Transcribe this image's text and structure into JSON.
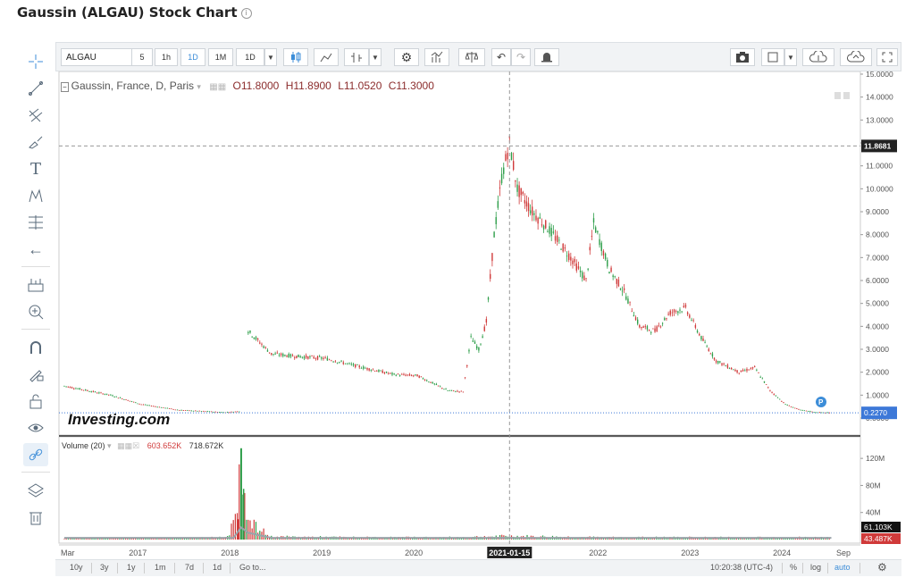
{
  "page_title": "Gaussin (ALGAU) Stock Chart",
  "toolbar": {
    "symbol": "ALGAU",
    "intervals": [
      "5",
      "1h",
      "1D",
      "1M",
      "1D"
    ],
    "selected_interval": "1D"
  },
  "legend": {
    "name": "Gaussin, France, D, Paris",
    "open": "O11.8000",
    "high": "H11.8900",
    "low": "L11.0520",
    "close": "C11.3000"
  },
  "volume_legend": {
    "label": "Volume (20)",
    "value1": "603.652K",
    "value2": "718.672K"
  },
  "watermark": "Investing.com",
  "bottom_bar": {
    "ranges": [
      "10y",
      "3y",
      "1y",
      "1m",
      "7d",
      "1d",
      "Go to..."
    ],
    "time": "10:20:38 (UTC-4)",
    "pct": "%",
    "log": "log",
    "auto": "auto"
  },
  "chart_data": {
    "type": "line",
    "title": "Gaussin, France, D, Paris",
    "x": [
      "2016-03",
      "2016-06",
      "2016-09",
      "2017-01",
      "2017-06",
      "2017-12",
      "2018-02",
      "2018-03",
      "2018-06",
      "2018-09",
      "2019-01",
      "2019-06",
      "2019-10",
      "2020-01",
      "2020-05",
      "2020-07",
      "2020-08",
      "2020-09",
      "2020-10",
      "2020-11",
      "2020-12",
      "2021-01",
      "2021-02",
      "2021-04",
      "2021-06",
      "2021-09",
      "2021-11",
      "2021-12",
      "2022-02",
      "2022-04",
      "2022-06",
      "2022-08",
      "2022-10",
      "2022-12",
      "2023-02",
      "2023-04",
      "2023-07",
      "2023-09",
      "2023-11",
      "2024-01",
      "2024-03",
      "2024-05",
      "2024-07"
    ],
    "series": [
      {
        "name": "",
        "values": [
          1.4,
          1.2,
          1.0,
          0.6,
          0.35,
          0.25,
          0.3,
          3.8,
          2.8,
          2.7,
          2.6,
          2.2,
          1.9,
          1.85,
          1.2,
          1.15,
          3.5,
          3.0,
          4.2,
          8.0,
          10.5,
          12.0,
          10.0,
          9.0,
          8.3,
          7.0,
          6.0,
          8.5,
          6.5,
          5.5,
          4.0,
          3.8,
          4.6,
          4.8,
          3.5,
          2.5,
          2.0,
          2.2,
          1.2,
          0.6,
          0.35,
          0.25,
          0.23
        ]
      }
    ],
    "volume": {
      "label": "Volume (20)",
      "dates": [
        "2016-03",
        "2017-01",
        "2017-12",
        "2018-01",
        "2018-02",
        "2018-03",
        "2018-06",
        "2019-06",
        "2020-06",
        "2020-09",
        "2021-01",
        "2022-01",
        "2023-01",
        "2024-01",
        "2024-07"
      ],
      "values": [
        2,
        2,
        3,
        20,
        135,
        25,
        4,
        3,
        3,
        4,
        5,
        3,
        3,
        3,
        3
      ]
    },
    "y_ticks": [
      "15.0000",
      "14.0000",
      "13.0000",
      "12.0000",
      "11.0000",
      "10.0000",
      "9.0000",
      "8.0000",
      "7.0000",
      "6.0000",
      "5.0000",
      "4.0000",
      "3.0000",
      "2.0000",
      "1.0000",
      "0.0000"
    ],
    "ylim": [
      0,
      15
    ],
    "volume_ticks": [
      "120M",
      "80M",
      "40M"
    ],
    "x_ticks": [
      "Mar",
      "2017",
      "2018",
      "2019",
      "2020",
      "2021-01-15",
      "2022",
      "2023",
      "2024",
      "Sep"
    ],
    "crosshair_date": "2021-01-15",
    "crosshair_price": "11.8681",
    "last_price": "0.2270",
    "volume_labels": [
      "61.103K",
      "43.487K"
    ],
    "colors": {
      "up": "#2e9e4a",
      "down": "#d03a3a",
      "price_label": "#3c78d8",
      "crosshair_label": "#222222",
      "volume_line": "#9aa3aa"
    },
    "grid": false
  }
}
